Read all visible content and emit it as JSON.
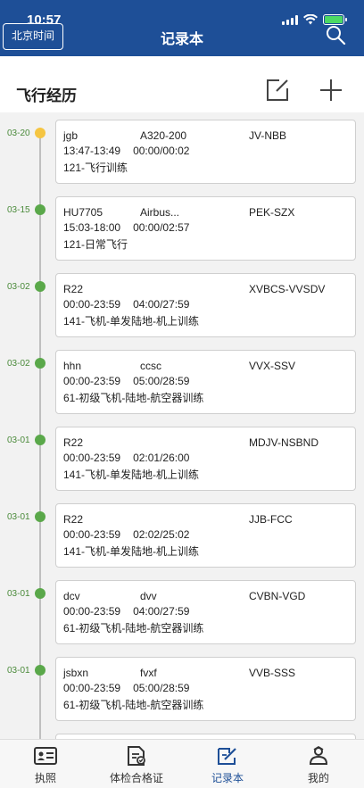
{
  "status_bar": {
    "time": "10:57"
  },
  "header": {
    "left_button": "北京时间",
    "title": "记录本"
  },
  "section": {
    "title": "飞行经历"
  },
  "records": [
    {
      "date": "03-20",
      "active": true,
      "flight": "jgb",
      "aircraft": "A320-200",
      "registration": "JV-NBB",
      "time_range": "13:47-13:49",
      "duration": "00:00/00:02",
      "type": "121-飞行训练"
    },
    {
      "date": "03-15",
      "active": false,
      "flight": "HU7705",
      "aircraft": "Airbus...",
      "registration": "PEK-SZX",
      "time_range": "15:03-18:00",
      "duration": "00:00/02:57",
      "type": "121-日常飞行"
    },
    {
      "date": "03-02",
      "active": false,
      "flight": "R22",
      "aircraft": "",
      "registration": "XVBCS-VVSDV",
      "time_range": "00:00-23:59",
      "duration": "04:00/27:59",
      "type": "141-飞机-单发陆地-机上训练"
    },
    {
      "date": "03-02",
      "active": false,
      "flight": "hhn",
      "aircraft": "ccsc",
      "registration": "VVX-SSV",
      "time_range": "00:00-23:59",
      "duration": "05:00/28:59",
      "type": "61-初级飞机-陆地-航空器训练"
    },
    {
      "date": "03-01",
      "active": false,
      "flight": "R22",
      "aircraft": "",
      "registration": "MDJV-NSBND",
      "time_range": "00:00-23:59",
      "duration": "02:01/26:00",
      "type": "141-飞机-单发陆地-机上训练"
    },
    {
      "date": "03-01",
      "active": false,
      "flight": "R22",
      "aircraft": "",
      "registration": "JJB-FCC",
      "time_range": "00:00-23:59",
      "duration": "02:02/25:02",
      "type": "141-飞机-单发陆地-机上训练"
    },
    {
      "date": "03-01",
      "active": false,
      "flight": "dcv",
      "aircraft": "dvv",
      "registration": "CVBN-VGD",
      "time_range": "00:00-23:59",
      "duration": "04:00/27:59",
      "type": "61-初级飞机-陆地-航空器训练"
    },
    {
      "date": "03-01",
      "active": false,
      "flight": "jsbxn",
      "aircraft": "fvxf",
      "registration": "VVB-SSS",
      "time_range": "00:00-23:59",
      "duration": "05:00/28:59",
      "type": "61-初级飞机-陆地-航空器训练"
    },
    {
      "date": "",
      "active": false,
      "flight": "",
      "aircraft": "",
      "registration": "",
      "time_range": "",
      "duration": "",
      "type": ""
    }
  ],
  "tabs": [
    {
      "label": "执照",
      "icon": "license-icon"
    },
    {
      "label": "体检合格证",
      "icon": "medical-certificate-icon"
    },
    {
      "label": "记录本",
      "icon": "logbook-icon",
      "active": true
    },
    {
      "label": "我的",
      "icon": "profile-icon"
    }
  ],
  "colors": {
    "primary": "#1e4f97",
    "timeline_dot": "#5aa84a",
    "active_dot": "#f5c542",
    "date_text": "#4a8a3a"
  }
}
